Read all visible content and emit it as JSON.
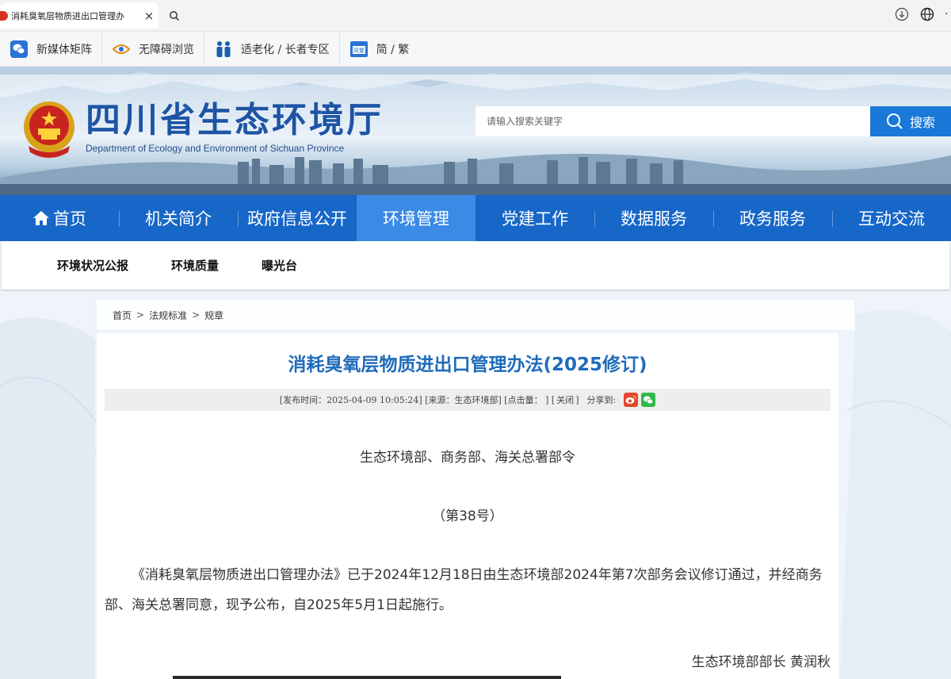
{
  "browser": {
    "tab_title": "消耗臭氧层物质进出口管理办",
    "close_glyph": "×",
    "more_glyph": "·"
  },
  "utility_bar": {
    "items": [
      {
        "label": "新媒体矩阵",
        "icon": "wechat-icon"
      },
      {
        "label": "无障碍浏览",
        "icon": "accessibility-eye-icon"
      },
      {
        "label": "适老化 / 长者专区",
        "icon": "elderly-people-icon"
      },
      {
        "label": "简 / 繁",
        "icon": "language-switch-icon"
      }
    ]
  },
  "header": {
    "site_title": "四川省生态环境厅",
    "site_subtitle": "Department of Ecology and Environment of Sichuan Province",
    "search_placeholder": "请输入搜索关键字",
    "search_button": "搜索"
  },
  "main_nav": {
    "items": [
      "首页",
      "机关简介",
      "政府信息公开",
      "环境管理",
      "党建工作",
      "数据服务",
      "政务服务",
      "互动交流"
    ],
    "active_index": 3
  },
  "sub_nav": {
    "items": [
      "环境状况公报",
      "环境质量",
      "曝光台"
    ]
  },
  "breadcrumb": {
    "items": [
      "首页",
      "法规标准",
      "规章"
    ],
    "separator": ">"
  },
  "article": {
    "title": "消耗臭氧层物质进出口管理办法(2025修订)",
    "meta_published": "[发布时间：2025-04-09 10:05:24]",
    "meta_source": "[来源：生态环境部]",
    "meta_clicks": "[点击量： ]",
    "meta_close_open": "[",
    "meta_close": "关闭",
    "meta_close_end": "]",
    "share_label": "分享到:",
    "issuer": "生态环境部、商务部、海关总署部令",
    "number": "（第38号）",
    "paragraph": "《消耗臭氧层物质进出口管理办法》已于2024年12月18日由生态环境部2024年第7次部务会议修订通过，并经商务部、海关总署同意，现予公布，自2025年5月1日起施行。",
    "signatory": "生态环境部部长 黄润秋"
  },
  "colors": {
    "nav_blue": "#1767c8",
    "nav_active": "#3a8ae6",
    "title_blue": "#1f6bbb",
    "search_blue": "#1a78d8"
  }
}
